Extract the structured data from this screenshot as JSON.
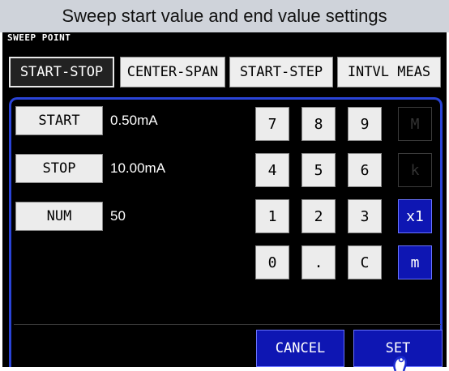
{
  "caption": "Sweep start value and end value settings",
  "screen_label": "SWEEP POINT",
  "mode_tabs": [
    {
      "label": "START-STOP",
      "active": true
    },
    {
      "label": "CENTER-SPAN",
      "active": false
    },
    {
      "label": "START-STEP",
      "active": false
    },
    {
      "label": "INTVL MEAS",
      "active": false
    }
  ],
  "rows": [
    {
      "label": "START",
      "value": "0.50mA"
    },
    {
      "label": "STOP",
      "value": "10.00mA"
    },
    {
      "label": "NUM",
      "value": "50"
    }
  ],
  "keypad": {
    "digits": [
      "7",
      "8",
      "9",
      "4",
      "5",
      "6",
      "1",
      "2",
      "3",
      "0",
      ".",
      "C"
    ],
    "units": [
      {
        "label": "M",
        "enabled": false
      },
      {
        "label": "k",
        "enabled": false
      },
      {
        "label": "x1",
        "enabled": true
      },
      {
        "label": "m",
        "enabled": true
      }
    ]
  },
  "actions": {
    "cancel": "CANCEL",
    "set": "SET"
  },
  "colors": {
    "panel_border": "#2a44d8",
    "button_blue": "#0e16b3",
    "caption_bg": "#cfd3da"
  }
}
